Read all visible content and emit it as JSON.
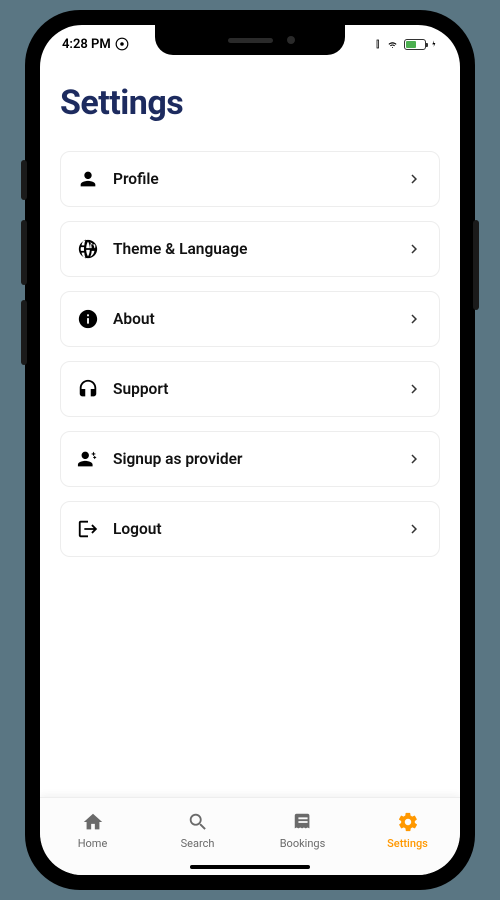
{
  "status": {
    "time": "4:28 PM"
  },
  "page": {
    "title": "Settings"
  },
  "settings_items": [
    {
      "id": "profile",
      "label": "Profile",
      "icon": "person"
    },
    {
      "id": "theme-language",
      "label": "Theme & Language",
      "icon": "globe"
    },
    {
      "id": "about",
      "label": "About",
      "icon": "info"
    },
    {
      "id": "support",
      "label": "Support",
      "icon": "headset"
    },
    {
      "id": "signup-provider",
      "label": "Signup as provider",
      "icon": "provider"
    },
    {
      "id": "logout",
      "label": "Logout",
      "icon": "logout"
    }
  ],
  "nav": {
    "active": "settings",
    "items": [
      {
        "id": "home",
        "label": "Home"
      },
      {
        "id": "search",
        "label": "Search"
      },
      {
        "id": "bookings",
        "label": "Bookings"
      },
      {
        "id": "settings",
        "label": "Settings"
      }
    ]
  }
}
